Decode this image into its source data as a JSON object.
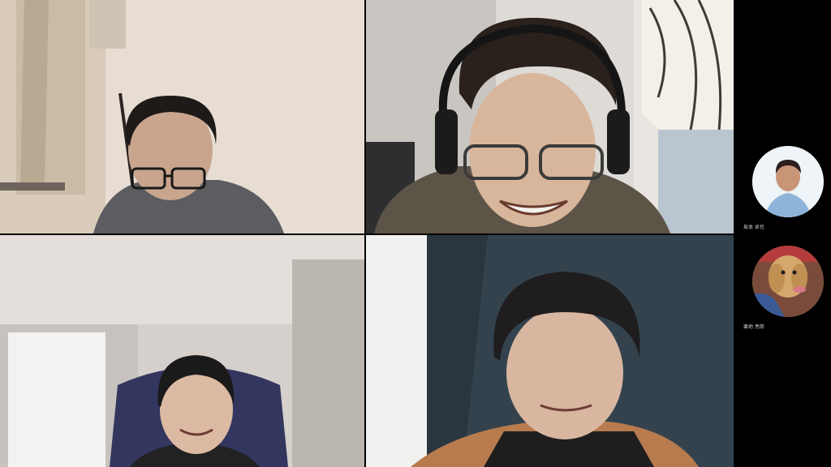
{
  "participants": [
    {
      "name": "坂本 卓也"
    },
    {
      "name": "栗地 亮郎"
    }
  ]
}
